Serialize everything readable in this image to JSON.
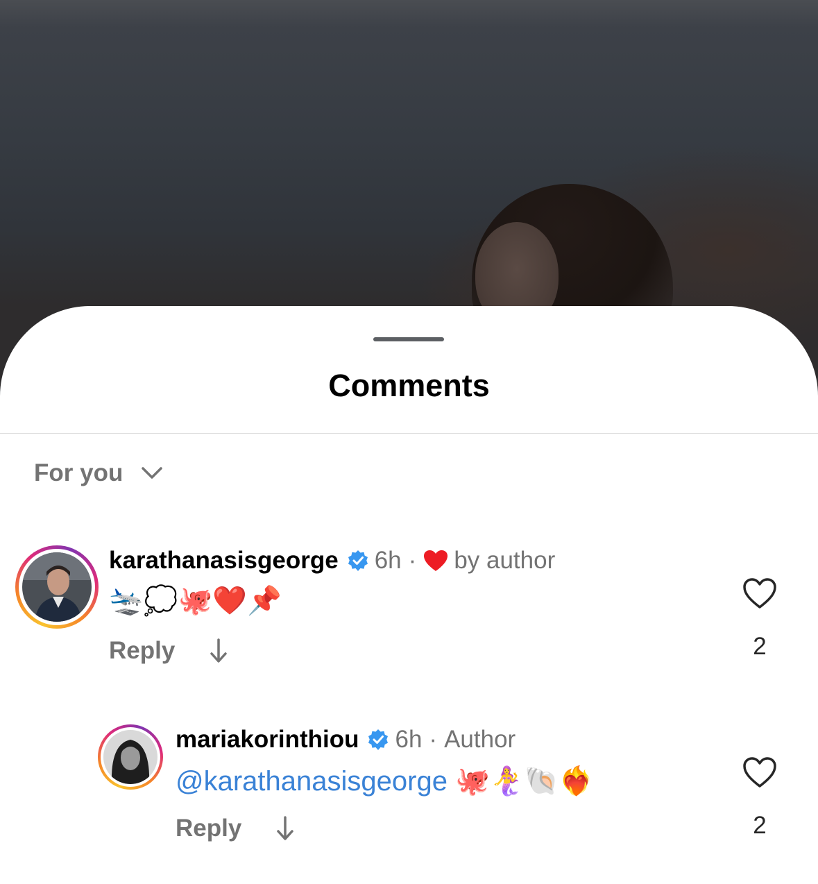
{
  "sheet": {
    "title": "Comments",
    "sort_label": "For you"
  },
  "comments": [
    {
      "username": "karathanasisgeorge",
      "verified": true,
      "time": "6h",
      "separator": "·",
      "liked_label": "by author",
      "text": "🛬💭🐙❤️📌",
      "reply_label": "Reply",
      "like_count": "2",
      "avatar_icon": "profile-photo-man"
    },
    {
      "username": "mariakorinthiou",
      "verified": true,
      "time": "6h",
      "separator": "·",
      "role_label": "Author",
      "mention": "@karathanasisgeorge",
      "text": "🐙🧜‍♀️🐚❤️‍🔥",
      "reply_label": "Reply",
      "like_count": "2",
      "avatar_icon": "profile-photo-woman"
    }
  ],
  "colors": {
    "accent_link": "#3a82d6",
    "verified_badge": "#3897f0",
    "liked_heart": "#ed1c24",
    "secondary_text": "#737373"
  }
}
